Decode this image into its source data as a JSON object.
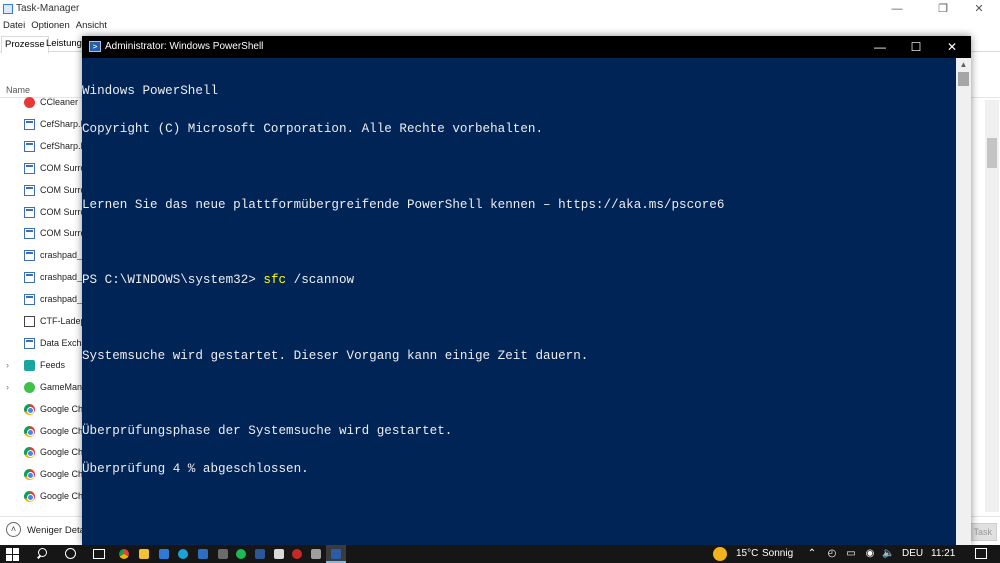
{
  "task_manager": {
    "title": "Task-Manager",
    "menu": [
      "Datei",
      "Optionen",
      "Ansicht"
    ],
    "tabs": [
      "Prozesse",
      "Leistung"
    ],
    "column_name": "Name",
    "processes": [
      {
        "label": "CCleaner",
        "icon": "ccleaner-icon",
        "expand": false
      },
      {
        "label": "CefSharp.B",
        "icon": "app-window-icon",
        "expand": false
      },
      {
        "label": "CefSharp.B",
        "icon": "app-window-icon",
        "expand": false
      },
      {
        "label": "COM Surro",
        "icon": "app-window-icon",
        "expand": false
      },
      {
        "label": "COM Surro",
        "icon": "app-window-icon",
        "expand": false
      },
      {
        "label": "COM Surro",
        "icon": "app-window-icon",
        "expand": false
      },
      {
        "label": "COM Surro",
        "icon": "app-window-icon",
        "expand": false
      },
      {
        "label": "crashpad_",
        "icon": "app-window-icon",
        "expand": false
      },
      {
        "label": "crashpad_",
        "icon": "app-window-icon",
        "expand": false
      },
      {
        "label": "crashpad_",
        "icon": "app-window-icon",
        "expand": false
      },
      {
        "label": "CTF-Ladep",
        "icon": "ctf-icon",
        "expand": false
      },
      {
        "label": "Data Excha",
        "icon": "app-window-icon",
        "expand": false
      },
      {
        "label": "Feeds",
        "icon": "feeds-icon",
        "expand": true
      },
      {
        "label": "GameMana",
        "icon": "gamemanager-icon",
        "expand": true
      },
      {
        "label": "Google Ch",
        "icon": "chrome-icon",
        "expand": false
      },
      {
        "label": "Google Ch",
        "icon": "chrome-icon",
        "expand": false
      },
      {
        "label": "Google Ch",
        "icon": "chrome-icon",
        "expand": false
      },
      {
        "label": "Google Ch",
        "icon": "chrome-icon",
        "expand": false
      },
      {
        "label": "Google Ch",
        "icon": "chrome-icon",
        "expand": false
      }
    ],
    "fewer_details": "Weniger Details",
    "end_task": "Task beenden"
  },
  "powershell": {
    "title": "Administrator: Windows PowerShell",
    "lines": {
      "l1": "Windows PowerShell",
      "l2": "Copyright (C) Microsoft Corporation. Alle Rechte vorbehalten.",
      "l3": "Lernen Sie das neue plattformübergreifende PowerShell kennen – https://aka.ms/pscore6",
      "prompt": "PS C:\\WINDOWS\\system32> ",
      "command": "sfc",
      "args": " /scannow",
      "l5": "Systemsuche wird gestartet. Dieser Vorgang kann einige Zeit dauern.",
      "l6": "Überprüfungsphase der Systemsuche wird gestartet.",
      "l7": "Überprüfung 4 % abgeschlossen."
    },
    "colors": {
      "background": "#012456",
      "text": "#eeedf0",
      "command": "#ffff00"
    }
  },
  "taskbar": {
    "weather_temp": "15°C",
    "weather_text": "Sonnig",
    "language": "DEU",
    "time": "11:21"
  }
}
